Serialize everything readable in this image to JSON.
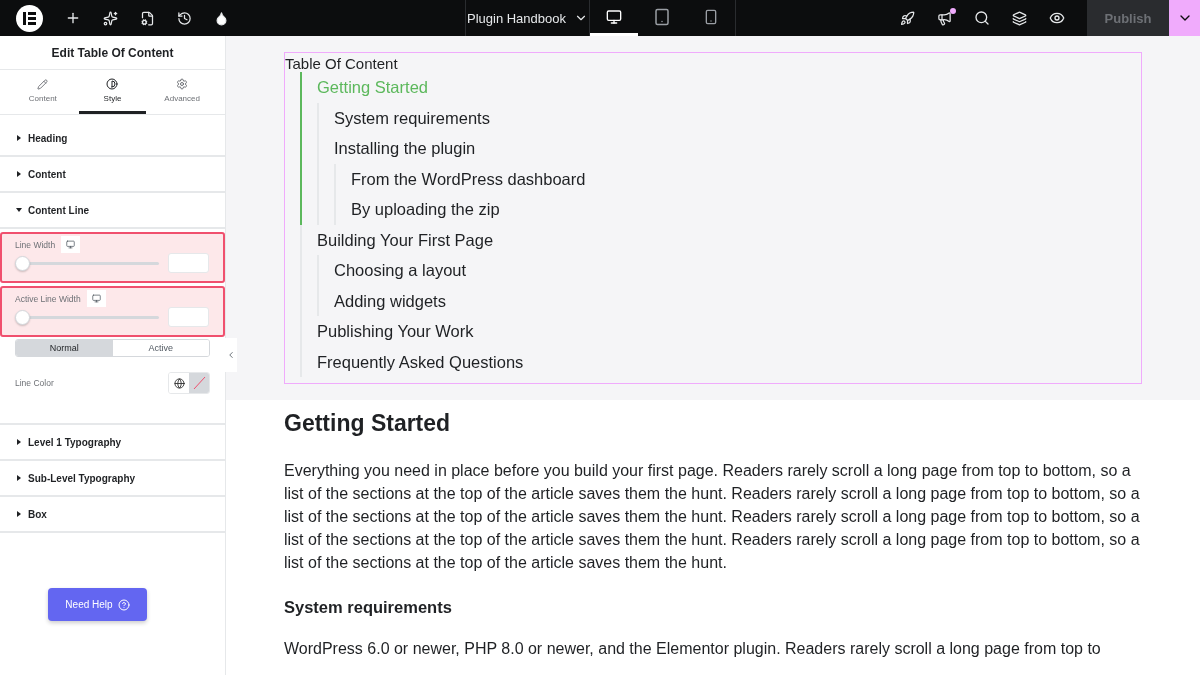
{
  "topbar": {
    "document_title": "Plugin Handbook",
    "publish": "Publish",
    "notification_dot": true,
    "devices": [
      {
        "kind": "desktop",
        "selected": true
      },
      {
        "kind": "tablet",
        "selected": false
      },
      {
        "kind": "mobile",
        "selected": false
      }
    ]
  },
  "panel": {
    "title": "Edit Table Of Content",
    "tabs": [
      {
        "kind": "pencil",
        "label": "Content",
        "selected": false
      },
      {
        "kind": "contrast",
        "label": "Style",
        "selected": true
      },
      {
        "kind": "gear",
        "label": "Advanced",
        "selected": false
      }
    ],
    "sections_before": [
      {
        "label": "Heading",
        "expanded": false
      },
      {
        "label": "Content",
        "expanded": false
      },
      {
        "label": "Content Line",
        "expanded": true
      }
    ],
    "sliders": [
      {
        "label": "Line Width",
        "level": 0
      },
      {
        "label": "Active Line Width",
        "level": 0
      }
    ],
    "state_tabs": [
      {
        "label": "Normal",
        "selected": true
      },
      {
        "label": "Active",
        "selected": false
      }
    ],
    "line_color_label": "Line Color",
    "sections_after": [
      {
        "label": "Level 1 Typography",
        "expanded": false
      },
      {
        "label": "Sub-Level Typography",
        "expanded": false
      },
      {
        "label": "Box",
        "expanded": false
      }
    ],
    "help_button": "Need Help"
  },
  "toc": {
    "heading": "Table Of Content",
    "items": [
      {
        "label": "Getting Started",
        "active": true,
        "children": [
          {
            "label": "System requirements",
            "active": false
          },
          {
            "label": "Installing the plugin",
            "active": false,
            "children": [
              {
                "label": "From the WordPress dashboard",
                "active": false
              },
              {
                "label": "By uploading the zip",
                "active": false
              }
            ]
          }
        ]
      },
      {
        "label": "Building Your First Page",
        "active": false,
        "children": [
          {
            "label": "Choosing a layout",
            "active": false
          },
          {
            "label": "Adding widgets",
            "active": false
          }
        ]
      },
      {
        "label": "Publishing Your Work",
        "active": false
      },
      {
        "label": "Frequently Asked Questions",
        "active": false
      }
    ]
  },
  "article": [
    {
      "kind": "h2",
      "text": "Getting Started"
    },
    {
      "kind": "p",
      "text": "Everything you need in place before you build your first page. Readers rarely scroll a long page from top to bottom, so a list of the sections at the top of the article saves them the hunt. Readers rarely scroll a long page from top to bottom, so a list of the sections at the top of the article saves them the hunt. Readers rarely scroll a long page from top to bottom, so a list of the sections at the top of the article saves them the hunt. Readers rarely scroll a long page from top to bottom, so a list of the sections at the top of the article saves them the hunt."
    },
    {
      "kind": "h3",
      "text": "System requirements"
    },
    {
      "kind": "p",
      "text": "WordPress 6.0 or newer, PHP 8.0 or newer, and the Elementor plugin. Readers rarely scroll a long page from top to"
    }
  ]
}
